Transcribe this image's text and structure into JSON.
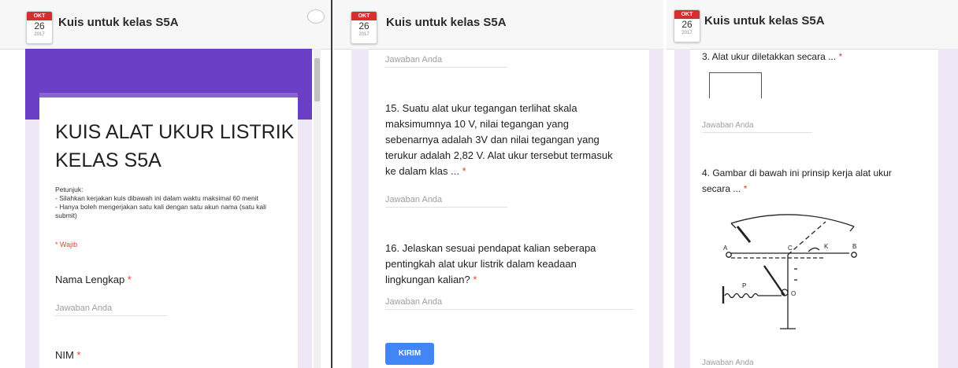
{
  "date_badge": {
    "month": "OKT",
    "day": "26",
    "year": "2017"
  },
  "app_title": "Kuis untuk kelas S5A",
  "panel1": {
    "form_title": [
      "KUIS ALAT UKUR LISTRIK",
      "KELAS S5A"
    ],
    "instructions": [
      "Petunjuk:",
      "- Silahkan kerjakan kuis dibawah ini dalam waktu maksimal 60 menit",
      "- Hanya boleh mengerjakan satu kali dengan satu akun nama (satu kali",
      "submit)"
    ],
    "required_note": "* Wajib",
    "questions": [
      {
        "label": "Nama Lengkap",
        "star": "*",
        "placeholder": "Jawaban Anda"
      },
      {
        "label": "NIM",
        "star": "*"
      }
    ]
  },
  "panel2": {
    "top_placeholder": "Jawaban Anda",
    "q15": {
      "lines": [
        "15. Suatu alat ukur tegangan terlihat skala",
        "maksimumnya 10 V, nilai tegangan yang",
        "sebenarnya adalah 3V dan nilai tegangan yang",
        "terukur adalah 2,82 V. Alat ukur tersebut termasuk",
        "ke dalam klas ..."
      ],
      "star": "*",
      "placeholder": "Jawaban Anda"
    },
    "q16": {
      "lines": [
        "16. Jelaskan sesuai pendapat kalian seberapa",
        "pentingkah alat ukur listrik dalam keadaan",
        "lingkungan kalian?"
      ],
      "star": "*",
      "placeholder": "Jawaban Anda"
    },
    "submit_label": "KIRIM"
  },
  "panel3": {
    "q3": {
      "label": "3. Alat ukur diletakkan secara ...",
      "star": "*",
      "placeholder": "Jawaban Anda"
    },
    "q4": {
      "lines": [
        "4. Gambar di bawah ini prinsip kerja alat ukur",
        "secara ..."
      ],
      "star": "*",
      "placeholder": "Jawaban Anda"
    },
    "diagram_labels": {
      "a": "A",
      "b": "B",
      "c": "C",
      "k": "K",
      "p": "P",
      "o": "O"
    }
  },
  "colors": {
    "accent": "#6a3fc6",
    "required": "#db4437",
    "button": "#4285f4"
  }
}
